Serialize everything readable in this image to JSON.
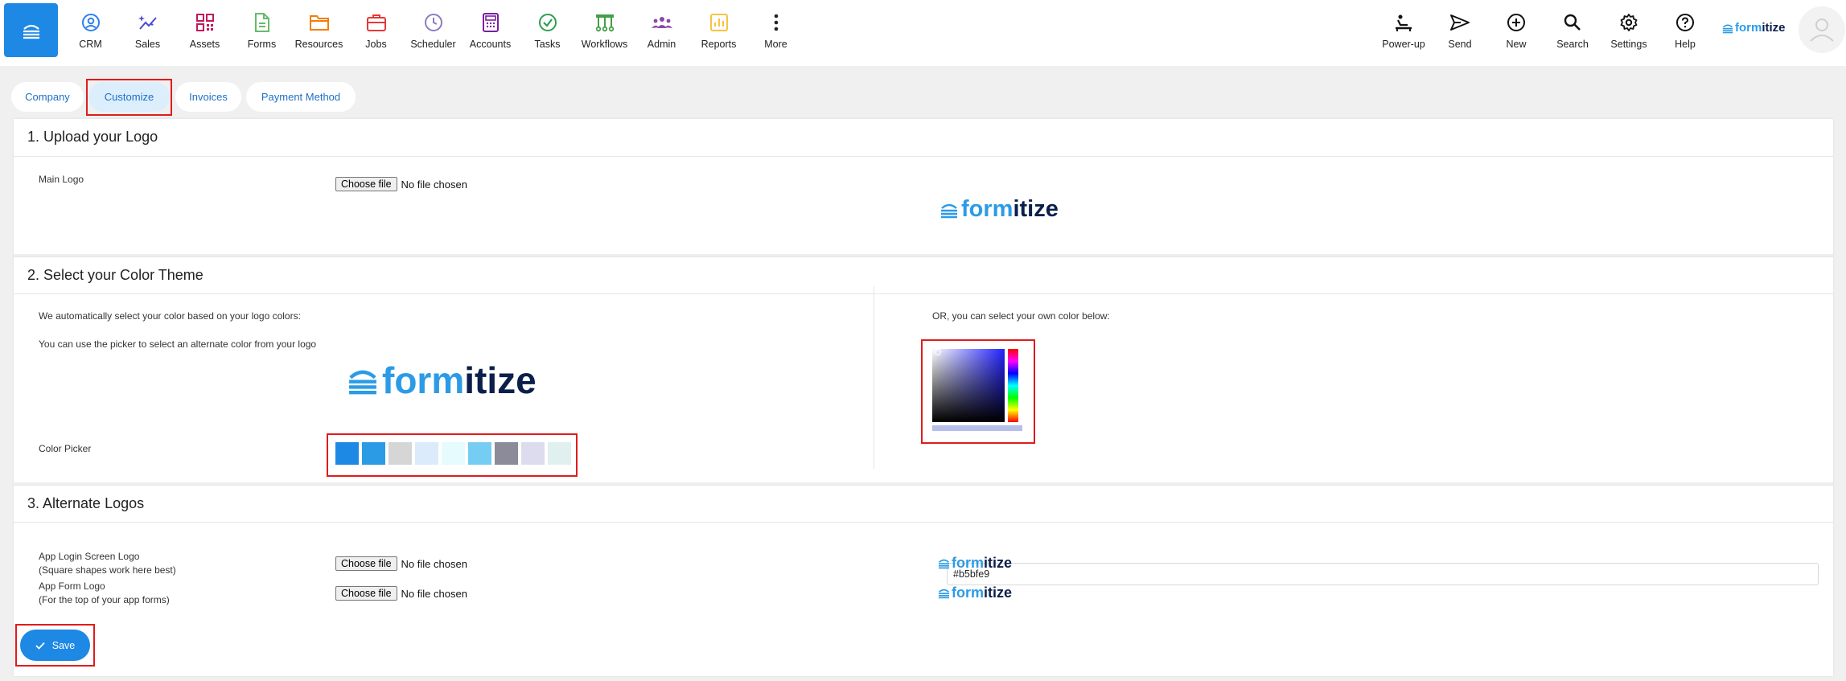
{
  "nav": {
    "left": [
      {
        "label": "CRM",
        "icon": "user-circle-icon",
        "color": "#2f80ed"
      },
      {
        "label": "Sales",
        "icon": "sparkle-chart-icon",
        "color": "#4b4bd0"
      },
      {
        "label": "Assets",
        "icon": "qr-code-icon",
        "color": "#c2185b"
      },
      {
        "label": "Forms",
        "icon": "document-icon",
        "color": "#66bb6a"
      },
      {
        "label": "Resources",
        "icon": "folder-icon",
        "color": "#f57c00"
      },
      {
        "label": "Jobs",
        "icon": "briefcase-icon",
        "color": "#e53935"
      },
      {
        "label": "Scheduler",
        "icon": "clock-icon",
        "color": "#8e7cc3"
      },
      {
        "label": "Accounts",
        "icon": "calculator-icon",
        "color": "#7b1fa2"
      },
      {
        "label": "Tasks",
        "icon": "check-circle-icon",
        "color": "#2e9d4f"
      },
      {
        "label": "Workflows",
        "icon": "workflow-icon",
        "color": "#43a047"
      },
      {
        "label": "Admin",
        "icon": "group-icon",
        "color": "#8e44ad"
      },
      {
        "label": "Reports",
        "icon": "bar-chart-icon",
        "color": "#f6c343"
      },
      {
        "label": "More",
        "icon": "more-vertical-icon",
        "color": "#222222"
      }
    ],
    "right": [
      {
        "label": "Power-up",
        "icon": "power-up-icon"
      },
      {
        "label": "Send",
        "icon": "send-icon"
      },
      {
        "label": "New",
        "icon": "plus-circle-icon"
      },
      {
        "label": "Search",
        "icon": "search-icon"
      },
      {
        "label": "Settings",
        "icon": "gear-icon"
      },
      {
        "label": "Help",
        "icon": "help-circle-icon"
      }
    ],
    "brand": {
      "prefix": "form",
      "suffix": "itize"
    }
  },
  "tabs": [
    "Company",
    "Customize",
    "Invoices",
    "Payment Method"
  ],
  "sections": {
    "logo": {
      "title": "1. Upload your Logo",
      "main_logo_label": "Main Logo",
      "choose_label": "Choose file",
      "no_file": "No file chosen"
    },
    "color": {
      "title": "2. Select your Color Theme",
      "auto_text": "We automatically select your color based on your logo colors:",
      "picker_text": "You can use the picker to select an alternate color from your logo",
      "color_picker_label": "Color Picker",
      "own_color_text": "OR, you can select your own color below:",
      "hex_value": "#b5bfe9",
      "swatches": [
        "#1e88e5",
        "#2b9be6",
        "#d6d6d6",
        "#dcebfb",
        "#e6fbfd",
        "#76cdf3",
        "#8b8b99",
        "#dcdcee",
        "#dff0ee"
      ]
    },
    "alt": {
      "title": "3. Alternate Logos",
      "login_label": "App Login Screen Logo",
      "login_hint": "(Square shapes work here best)",
      "form_label": "App Form Logo",
      "form_hint": "(For the top of your app forms)"
    }
  },
  "save_label": "Save",
  "colors": {
    "accent": "#1e88e5",
    "highlight": "#e01c1c",
    "brand_dark": "#0b1f4b"
  }
}
